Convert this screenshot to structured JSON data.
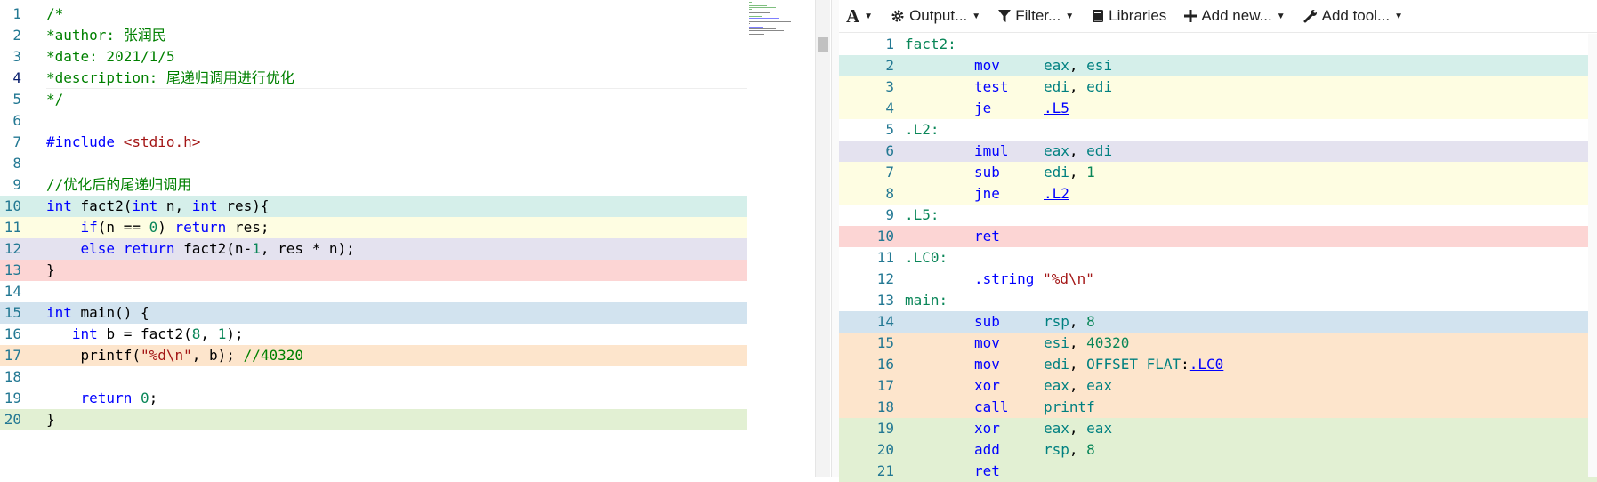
{
  "colors": {
    "teal": "#d5efea",
    "yellow": "#fefde2",
    "lavender": "#e4e2ef",
    "pink": "#fcd5d4",
    "blue": "#d2e3ef",
    "orange": "#fde5cc",
    "green": "#e2f0d3"
  },
  "source": {
    "lines": [
      {
        "n": "1",
        "bg": "",
        "tokens": [
          {
            "t": "/*",
            "c": "comment"
          }
        ]
      },
      {
        "n": "2",
        "bg": "",
        "tokens": [
          {
            "t": "*author: 张润民",
            "c": "comment"
          }
        ]
      },
      {
        "n": "3",
        "bg": "",
        "tokens": [
          {
            "t": "*date: 2021/1/5",
            "c": "comment"
          }
        ]
      },
      {
        "n": "4",
        "bg": "",
        "cur": true,
        "tokens": [
          {
            "t": "*description: 尾递归调用进行优化",
            "c": "comment"
          }
        ]
      },
      {
        "n": "5",
        "bg": "",
        "tokens": [
          {
            "t": "*/",
            "c": "comment"
          }
        ]
      },
      {
        "n": "6",
        "bg": "",
        "tokens": []
      },
      {
        "n": "7",
        "bg": "",
        "tokens": [
          {
            "t": "#include ",
            "c": "pre"
          },
          {
            "t": "<stdio.h>",
            "c": "string"
          }
        ]
      },
      {
        "n": "8",
        "bg": "",
        "tokens": []
      },
      {
        "n": "9",
        "bg": "",
        "tokens": [
          {
            "t": "//优化后的尾递归调用",
            "c": "comment"
          }
        ]
      },
      {
        "n": "10",
        "bg": "teal",
        "tokens": [
          {
            "t": "int",
            "c": "keyword"
          },
          {
            "t": " fact2(",
            "c": "plain"
          },
          {
            "t": "int",
            "c": "keyword"
          },
          {
            "t": " n, ",
            "c": "plain"
          },
          {
            "t": "int",
            "c": "keyword"
          },
          {
            "t": " res){",
            "c": "plain"
          }
        ]
      },
      {
        "n": "11",
        "bg": "yellow",
        "tokens": [
          {
            "t": "    ",
            "c": "plain"
          },
          {
            "t": "if",
            "c": "keyword"
          },
          {
            "t": "(n == ",
            "c": "plain"
          },
          {
            "t": "0",
            "c": "number"
          },
          {
            "t": ") ",
            "c": "plain"
          },
          {
            "t": "return",
            "c": "keyword"
          },
          {
            "t": " res;",
            "c": "plain"
          }
        ]
      },
      {
        "n": "12",
        "bg": "lavender",
        "tokens": [
          {
            "t": "    ",
            "c": "plain"
          },
          {
            "t": "else",
            "c": "keyword"
          },
          {
            "t": " ",
            "c": "plain"
          },
          {
            "t": "return",
            "c": "keyword"
          },
          {
            "t": " fact2(n-",
            "c": "plain"
          },
          {
            "t": "1",
            "c": "number"
          },
          {
            "t": ", res * n);",
            "c": "plain"
          }
        ]
      },
      {
        "n": "13",
        "bg": "pink",
        "tokens": [
          {
            "t": "}",
            "c": "plain"
          }
        ]
      },
      {
        "n": "14",
        "bg": "",
        "tokens": []
      },
      {
        "n": "15",
        "bg": "blue",
        "tokens": [
          {
            "t": "int",
            "c": "keyword"
          },
          {
            "t": " main() {",
            "c": "plain"
          }
        ]
      },
      {
        "n": "16",
        "bg": "",
        "tokens": [
          {
            "t": "   ",
            "c": "plain"
          },
          {
            "t": "int",
            "c": "keyword"
          },
          {
            "t": " b = fact2(",
            "c": "plain"
          },
          {
            "t": "8",
            "c": "number"
          },
          {
            "t": ", ",
            "c": "plain"
          },
          {
            "t": "1",
            "c": "number"
          },
          {
            "t": ");",
            "c": "plain"
          }
        ]
      },
      {
        "n": "17",
        "bg": "orange",
        "tokens": [
          {
            "t": "    printf(",
            "c": "plain"
          },
          {
            "t": "\"%d\\n\"",
            "c": "string"
          },
          {
            "t": ", b); ",
            "c": "plain"
          },
          {
            "t": "//40320",
            "c": "comment"
          }
        ]
      },
      {
        "n": "18",
        "bg": "",
        "tokens": []
      },
      {
        "n": "19",
        "bg": "",
        "tokens": [
          {
            "t": "    ",
            "c": "plain"
          },
          {
            "t": "return",
            "c": "keyword"
          },
          {
            "t": " ",
            "c": "plain"
          },
          {
            "t": "0",
            "c": "number"
          },
          {
            "t": ";",
            "c": "plain"
          }
        ]
      },
      {
        "n": "20",
        "bg": "green",
        "tokens": [
          {
            "t": "}",
            "c": "plain"
          }
        ]
      }
    ]
  },
  "toolbar": {
    "font_label": "A",
    "output_label": "Output...",
    "filter_label": "Filter...",
    "libraries_label": "Libraries",
    "add_new_label": "Add new...",
    "add_tool_label": "Add tool..."
  },
  "asm": {
    "lines": [
      {
        "n": "1",
        "bg": "",
        "label": "fact2:"
      },
      {
        "n": "2",
        "bg": "teal",
        "ins": "mov",
        "ops": [
          {
            "t": "eax",
            "c": "reg"
          },
          {
            "t": ", ",
            "c": "p"
          },
          {
            "t": "esi",
            "c": "reg"
          }
        ]
      },
      {
        "n": "3",
        "bg": "yellow",
        "ins": "test",
        "ops": [
          {
            "t": "edi",
            "c": "reg"
          },
          {
            "t": ", ",
            "c": "p"
          },
          {
            "t": "edi",
            "c": "reg"
          }
        ]
      },
      {
        "n": "4",
        "bg": "yellow",
        "ins": "je",
        "ops": [
          {
            "t": ".L5",
            "c": "link"
          }
        ]
      },
      {
        "n": "5",
        "bg": "",
        "label": ".L2:"
      },
      {
        "n": "6",
        "bg": "lavender",
        "ins": "imul",
        "ops": [
          {
            "t": "eax",
            "c": "reg"
          },
          {
            "t": ", ",
            "c": "p"
          },
          {
            "t": "edi",
            "c": "reg"
          }
        ]
      },
      {
        "n": "7",
        "bg": "yellow",
        "ins": "sub",
        "ops": [
          {
            "t": "edi",
            "c": "reg"
          },
          {
            "t": ", ",
            "c": "p"
          },
          {
            "t": "1",
            "c": "num"
          }
        ]
      },
      {
        "n": "8",
        "bg": "yellow",
        "ins": "jne",
        "ops": [
          {
            "t": ".L2",
            "c": "link"
          }
        ]
      },
      {
        "n": "9",
        "bg": "",
        "label": ".L5:"
      },
      {
        "n": "10",
        "bg": "pink",
        "ins": "ret",
        "ops": []
      },
      {
        "n": "11",
        "bg": "",
        "label": ".LC0:"
      },
      {
        "n": "12",
        "bg": "",
        "directive": ".string ",
        "ops": [
          {
            "t": "\"%d\\n\"",
            "c": "str"
          }
        ]
      },
      {
        "n": "13",
        "bg": "",
        "label": "main:"
      },
      {
        "n": "14",
        "bg": "blue",
        "ins": "sub",
        "ops": [
          {
            "t": "rsp",
            "c": "reg"
          },
          {
            "t": ", ",
            "c": "p"
          },
          {
            "t": "8",
            "c": "num"
          }
        ]
      },
      {
        "n": "15",
        "bg": "orange",
        "ins": "mov",
        "ops": [
          {
            "t": "esi",
            "c": "reg"
          },
          {
            "t": ", ",
            "c": "p"
          },
          {
            "t": "40320",
            "c": "num"
          }
        ]
      },
      {
        "n": "16",
        "bg": "orange",
        "ins": "mov",
        "ops": [
          {
            "t": "edi",
            "c": "reg"
          },
          {
            "t": ", ",
            "c": "p"
          },
          {
            "t": "OFFSET FLAT",
            "c": "reg"
          },
          {
            "t": ":",
            "c": "p"
          },
          {
            "t": ".LC0",
            "c": "link"
          }
        ]
      },
      {
        "n": "17",
        "bg": "orange",
        "ins": "xor",
        "ops": [
          {
            "t": "eax",
            "c": "reg"
          },
          {
            "t": ", ",
            "c": "p"
          },
          {
            "t": "eax",
            "c": "reg"
          }
        ]
      },
      {
        "n": "18",
        "bg": "orange",
        "ins": "call",
        "ops": [
          {
            "t": "printf",
            "c": "reg"
          }
        ]
      },
      {
        "n": "19",
        "bg": "green",
        "ins": "xor",
        "ops": [
          {
            "t": "eax",
            "c": "reg"
          },
          {
            "t": ", ",
            "c": "p"
          },
          {
            "t": "eax",
            "c": "reg"
          }
        ]
      },
      {
        "n": "20",
        "bg": "green",
        "ins": "add",
        "ops": [
          {
            "t": "rsp",
            "c": "reg"
          },
          {
            "t": ", ",
            "c": "p"
          },
          {
            "t": "8",
            "c": "num"
          }
        ]
      },
      {
        "n": "21",
        "bg": "green",
        "ins": "ret",
        "ops": []
      }
    ]
  }
}
